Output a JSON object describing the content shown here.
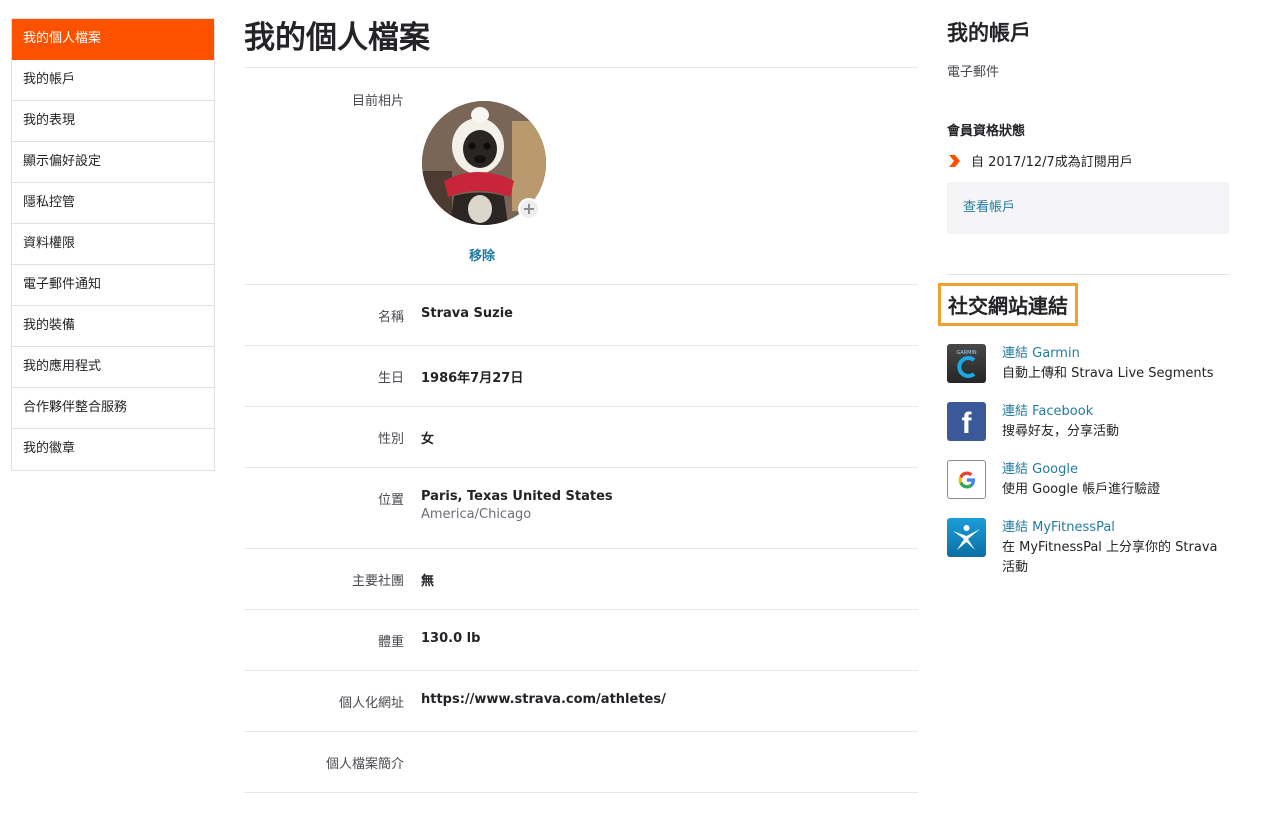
{
  "sidebar": {
    "items": [
      {
        "label": "我的個人檔案",
        "active": true
      },
      {
        "label": "我的帳戶"
      },
      {
        "label": "我的表現"
      },
      {
        "label": "顯示偏好設定"
      },
      {
        "label": "隱私控管"
      },
      {
        "label": "資料權限"
      },
      {
        "label": "電子郵件通知"
      },
      {
        "label": "我的裝備"
      },
      {
        "label": "我的應用程式"
      },
      {
        "label": "合作夥伴整合服務"
      },
      {
        "label": "我的徽章"
      }
    ]
  },
  "profile": {
    "title": "我的個人檔案",
    "photo_label": "目前相片",
    "remove_label": "移除",
    "fields": {
      "name": {
        "label": "名稱",
        "value": "Strava Suzie"
      },
      "birthday": {
        "label": "生日",
        "value": "1986年7月27日"
      },
      "gender": {
        "label": "性別",
        "value": "女"
      },
      "location": {
        "label": "位置",
        "value": "Paris, Texas United States",
        "timezone": "America/Chicago"
      },
      "primary_club": {
        "label": "主要社團",
        "value": "無"
      },
      "weight": {
        "label": "體重",
        "value": "130.0 lb"
      },
      "custom_url": {
        "label": "個人化網址",
        "value": "https://www.strava.com/athletes/"
      },
      "bio": {
        "label": "個人檔案簡介",
        "value": ""
      }
    }
  },
  "account": {
    "title": "我的帳戶",
    "email_label": "電子郵件",
    "membership_title": "會員資格狀態",
    "membership_status": "自 2017/12/7成為訂閱用戶",
    "view_account": "查看帳戶"
  },
  "social": {
    "title": "社交網站連結",
    "connections": [
      {
        "link": "連結 Garmin",
        "desc": "自動上傳和 Strava Live Segments",
        "icon": "garmin-icon"
      },
      {
        "link": "連結 Facebook",
        "desc": "搜尋好友，分享活動",
        "icon": "facebook-icon"
      },
      {
        "link": "連結 Google",
        "desc": "使用 Google 帳戶進行驗證",
        "icon": "google-icon"
      },
      {
        "link": "連結 MyFitnessPal",
        "desc": "在 MyFitnessPal 上分享你的 Strava 活動",
        "icon": "myfitnesspal-icon"
      }
    ]
  },
  "colors": {
    "brand_orange": "#fc5200",
    "link_blue": "#247ba0",
    "highlight_border": "#f0a030"
  }
}
